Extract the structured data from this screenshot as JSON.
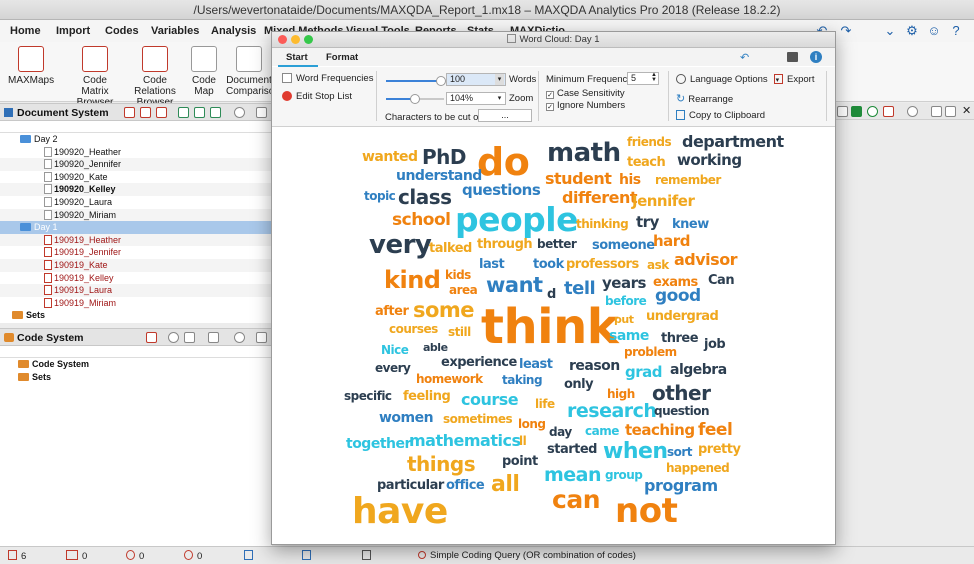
{
  "window": {
    "title": "/Users/wevertonataide/Documents/MAXQDA_Report_1.mx18 – MAXQDA Analytics Pro 2018 (Release 18.2.2)"
  },
  "menu": {
    "items": [
      "Home",
      "Import",
      "Codes",
      "Variables",
      "Analysis",
      "Mixed Methods",
      "Visual Tools",
      "Reports",
      "Stats",
      "MAXDictio"
    ]
  },
  "ribbon": {
    "buttons": [
      {
        "label": "MAXMaps"
      },
      {
        "label": "Code Matrix Browser"
      },
      {
        "label": "Code Relations Browser"
      },
      {
        "label": "Code Map"
      },
      {
        "label": "Document Comparison"
      }
    ]
  },
  "document_system": {
    "title": "Document System",
    "rows": [
      {
        "label": "Day 2",
        "type": "group",
        "bold": false
      },
      {
        "label": "190920_Heather",
        "type": "doc"
      },
      {
        "label": "190920_Jennifer",
        "type": "doc"
      },
      {
        "label": "190920_Kate",
        "type": "doc"
      },
      {
        "label": "190920_Kelley",
        "type": "doc",
        "bold": true
      },
      {
        "label": "190920_Laura",
        "type": "doc"
      },
      {
        "label": "190920_Miriam",
        "type": "doc"
      },
      {
        "label": "Day 1",
        "type": "group-selected"
      },
      {
        "label": "190919_Heather",
        "type": "doc-red"
      },
      {
        "label": "190919_Jennifer",
        "type": "doc-red"
      },
      {
        "label": "190919_Kate",
        "type": "doc-red"
      },
      {
        "label": "190919_Kelley",
        "type": "doc-red"
      },
      {
        "label": "190919_Laura",
        "type": "doc-red"
      },
      {
        "label": "190919_Miriam",
        "type": "doc-red"
      },
      {
        "label": "Sets",
        "type": "sets"
      }
    ]
  },
  "code_system": {
    "title": "Code System",
    "rows": [
      {
        "label": "Code System"
      },
      {
        "label": "Sets"
      }
    ]
  },
  "status": {
    "docs": "6",
    "segments": "0",
    "codes": "0",
    "memos": "0",
    "query": "Simple Coding Query (OR combination of codes)"
  },
  "word_cloud": {
    "title": "Word Cloud: Day 1",
    "tabs": [
      "Start",
      "Format"
    ],
    "word_frequencies_label": "Word Frequencies",
    "edit_stop_list_label": "Edit Stop List",
    "words_value": "100",
    "words_label": "Words",
    "zoom_value": "104%",
    "zoom_label": "Zoom",
    "chars_cut_label": "Characters to be cut off",
    "chars_cut_value": "...",
    "min_freq_label": "Minimum Frequency:",
    "min_freq_value": "5",
    "case_sensitivity_label": "Case Sensitivity",
    "ignore_numbers_label": "Ignore Numbers",
    "language_options_label": "Language Options",
    "export_label": "Export",
    "rearrange_label": "Rearrange",
    "copy_clipboard_label": "Copy to Clipboard",
    "colors": {
      "orange": "#f0820f",
      "navy": "#2c3e50",
      "cyan": "#2ec4e0",
      "blue": "#2f7fc1",
      "amber": "#f0a71e"
    },
    "words": [
      {
        "t": "wanted",
        "c": "amber"
      },
      {
        "t": "PhD",
        "c": "navy"
      },
      {
        "t": "do",
        "c": "orange"
      },
      {
        "t": "math",
        "c": "navy"
      },
      {
        "t": "friends",
        "c": "amber"
      },
      {
        "t": "department",
        "c": "navy"
      },
      {
        "t": "teach",
        "c": "amber"
      },
      {
        "t": "working",
        "c": "navy"
      },
      {
        "t": "understand",
        "c": "blue"
      },
      {
        "t": "student",
        "c": "orange"
      },
      {
        "t": "his",
        "c": "orange"
      },
      {
        "t": "remember",
        "c": "amber"
      },
      {
        "t": "topic",
        "c": "blue"
      },
      {
        "t": "class",
        "c": "navy"
      },
      {
        "t": "questions",
        "c": "blue"
      },
      {
        "t": "different",
        "c": "orange"
      },
      {
        "t": "Jennifer",
        "c": "amber"
      },
      {
        "t": "school",
        "c": "orange"
      },
      {
        "t": "people",
        "c": "cyan"
      },
      {
        "t": "thinking",
        "c": "amber"
      },
      {
        "t": "try",
        "c": "navy"
      },
      {
        "t": "knew",
        "c": "blue"
      },
      {
        "t": "very",
        "c": "navy"
      },
      {
        "t": "talked",
        "c": "amber"
      },
      {
        "t": "through",
        "c": "amber"
      },
      {
        "t": "better",
        "c": "navy"
      },
      {
        "t": "someone",
        "c": "blue"
      },
      {
        "t": "hard",
        "c": "orange"
      },
      {
        "t": "last",
        "c": "blue"
      },
      {
        "t": "took",
        "c": "blue"
      },
      {
        "t": "professors",
        "c": "amber"
      },
      {
        "t": "ask",
        "c": "amber"
      },
      {
        "t": "advisor",
        "c": "orange"
      },
      {
        "t": "kind",
        "c": "orange"
      },
      {
        "t": "kids",
        "c": "orange"
      },
      {
        "t": "want",
        "c": "blue"
      },
      {
        "t": "tell",
        "c": "blue"
      },
      {
        "t": "years",
        "c": "navy"
      },
      {
        "t": "exams",
        "c": "orange"
      },
      {
        "t": "Can",
        "c": "navy"
      },
      {
        "t": "area",
        "c": "orange"
      },
      {
        "t": "d",
        "c": "navy"
      },
      {
        "t": "good",
        "c": "blue"
      },
      {
        "t": "before",
        "c": "cyan"
      },
      {
        "t": "after",
        "c": "orange"
      },
      {
        "t": "some",
        "c": "amber"
      },
      {
        "t": "think",
        "c": "orange"
      },
      {
        "t": "put",
        "c": "amber"
      },
      {
        "t": "undergrad",
        "c": "amber"
      },
      {
        "t": "courses",
        "c": "amber"
      },
      {
        "t": "still",
        "c": "amber"
      },
      {
        "t": "same",
        "c": "cyan"
      },
      {
        "t": "three",
        "c": "navy"
      },
      {
        "t": "job",
        "c": "navy"
      },
      {
        "t": "Nice",
        "c": "cyan"
      },
      {
        "t": "able",
        "c": "navy"
      },
      {
        "t": "problem",
        "c": "orange"
      },
      {
        "t": "every",
        "c": "navy"
      },
      {
        "t": "experience",
        "c": "navy"
      },
      {
        "t": "least",
        "c": "blue"
      },
      {
        "t": "reason",
        "c": "navy"
      },
      {
        "t": "grad",
        "c": "cyan"
      },
      {
        "t": "algebra",
        "c": "navy"
      },
      {
        "t": "homework",
        "c": "orange"
      },
      {
        "t": "taking",
        "c": "blue"
      },
      {
        "t": "only",
        "c": "navy"
      },
      {
        "t": "specific",
        "c": "navy"
      },
      {
        "t": "feeling",
        "c": "amber"
      },
      {
        "t": "course",
        "c": "cyan"
      },
      {
        "t": "life",
        "c": "amber"
      },
      {
        "t": "high",
        "c": "orange"
      },
      {
        "t": "other",
        "c": "navy"
      },
      {
        "t": "women",
        "c": "blue"
      },
      {
        "t": "sometimes",
        "c": "amber"
      },
      {
        "t": "research",
        "c": "cyan"
      },
      {
        "t": "question",
        "c": "navy"
      },
      {
        "t": "long",
        "c": "orange"
      },
      {
        "t": "together",
        "c": "cyan"
      },
      {
        "t": "day",
        "c": "navy"
      },
      {
        "t": "came",
        "c": "cyan"
      },
      {
        "t": "teaching",
        "c": "orange"
      },
      {
        "t": "feel",
        "c": "orange"
      },
      {
        "t": "mathematics",
        "c": "cyan"
      },
      {
        "t": "ll",
        "c": "amber"
      },
      {
        "t": "started",
        "c": "navy"
      },
      {
        "t": "pretty",
        "c": "amber"
      },
      {
        "t": "when",
        "c": "cyan"
      },
      {
        "t": "sort",
        "c": "blue"
      },
      {
        "t": "things",
        "c": "amber"
      },
      {
        "t": "point",
        "c": "navy"
      },
      {
        "t": "happened",
        "c": "amber"
      },
      {
        "t": "mean",
        "c": "cyan"
      },
      {
        "t": "group",
        "c": "cyan"
      },
      {
        "t": "particular",
        "c": "navy"
      },
      {
        "t": "office",
        "c": "blue"
      },
      {
        "t": "all",
        "c": "amber"
      },
      {
        "t": "program",
        "c": "blue"
      },
      {
        "t": "can",
        "c": "orange"
      },
      {
        "t": "have",
        "c": "amber"
      },
      {
        "t": "not",
        "c": "orange"
      }
    ]
  }
}
